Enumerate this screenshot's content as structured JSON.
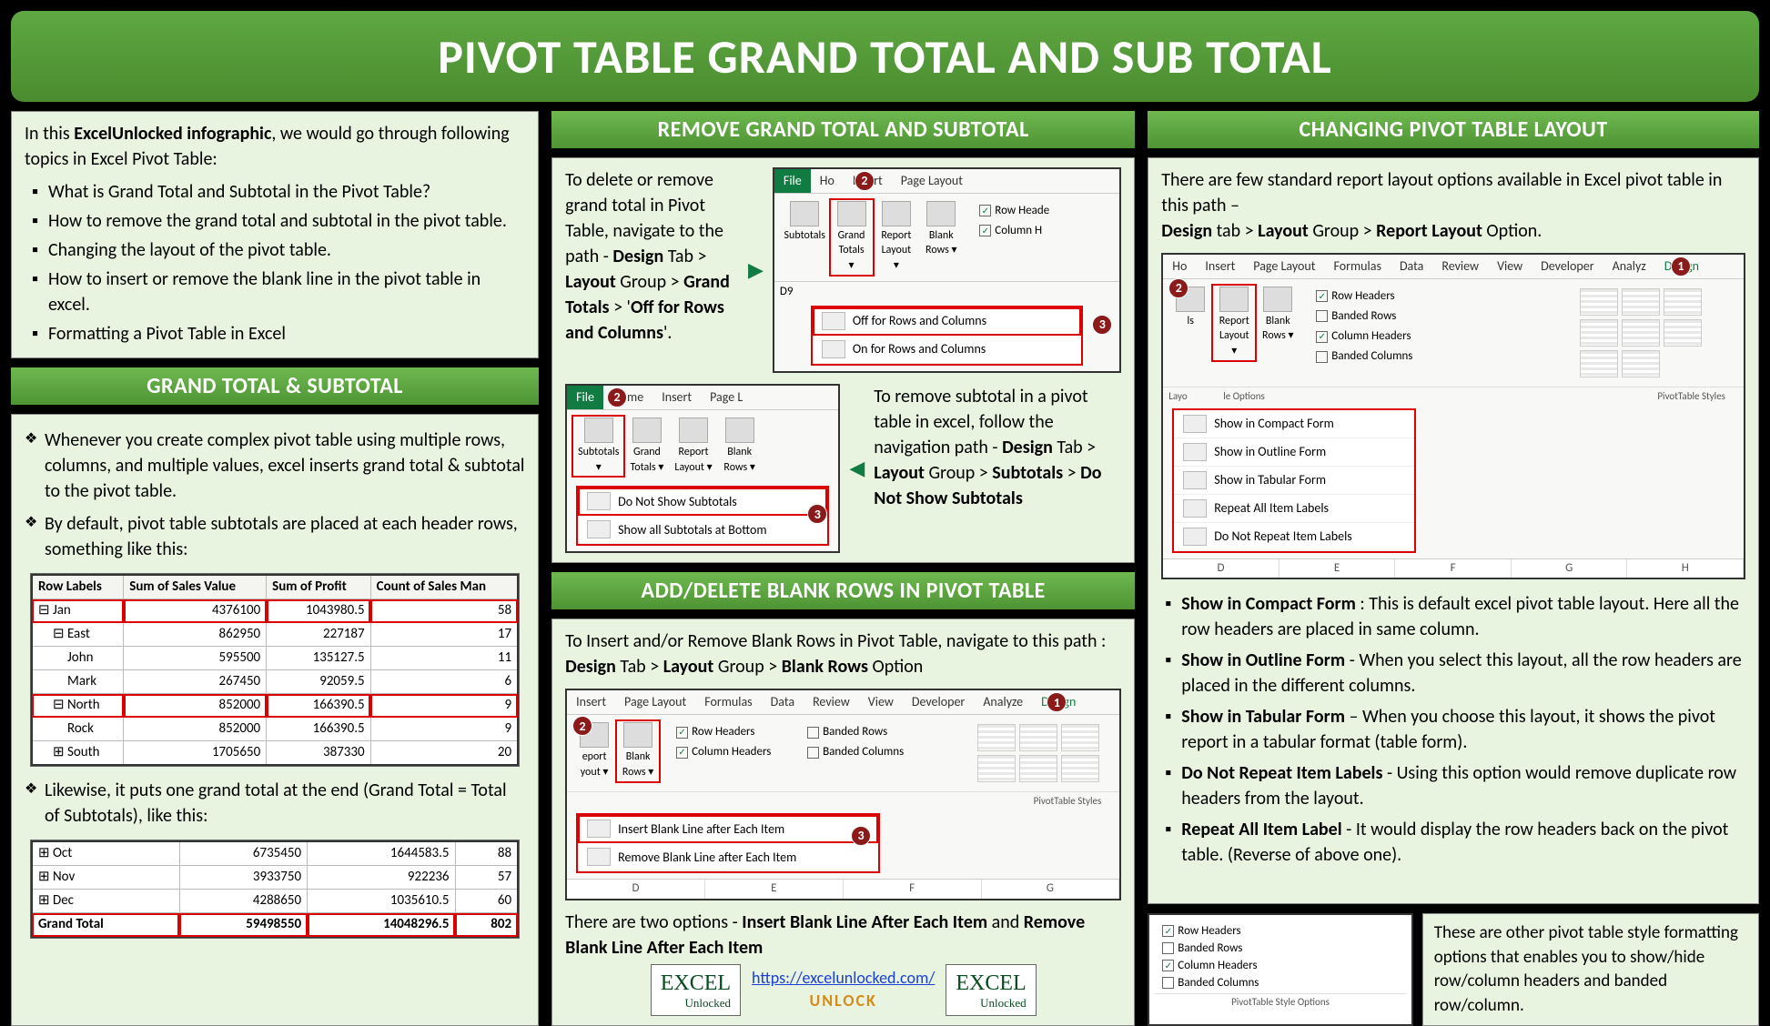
{
  "title": "PIVOT TABLE GRAND TOTAL AND SUB TOTAL",
  "intro": {
    "lead_html": "In this <b>ExcelUnlocked infographic</b>, we would go through following topics in Excel Pivot Table:",
    "topics": [
      "What is Grand Total and Subtotal in the Pivot Table?",
      "How to remove the grand total and subtotal in the pivot table.",
      "Changing the layout of the pivot table.",
      "How to insert or remove the blank line in the pivot table in excel.",
      "Formatting a Pivot Table in Excel"
    ]
  },
  "sec_gtst": {
    "header": "GRAND TOTAL & SUBTOTAL",
    "b1": "Whenever you create complex pivot table using multiple rows, columns, and multiple values, excel inserts grand total & subtotal to the pivot table.",
    "b2": "By default, pivot table subtotals are placed at each header rows, something like this:",
    "b3": "Likewise, it puts one grand total at the end (Grand Total = Total of Subtotals), like this:",
    "table1": {
      "headers": [
        "Row Labels",
        "Sum of Sales Value",
        "Sum of Profit",
        "Count of Sales Man"
      ],
      "rows": [
        {
          "lvl": 0,
          "exp": "⊟",
          "label": "Jan",
          "v": [
            "4376100",
            "1043980.5",
            "58"
          ],
          "hl": true
        },
        {
          "lvl": 1,
          "exp": "⊟",
          "label": "East",
          "v": [
            "862950",
            "227187",
            "17"
          ]
        },
        {
          "lvl": 2,
          "label": "John",
          "v": [
            "595500",
            "135127.5",
            "11"
          ]
        },
        {
          "lvl": 2,
          "label": "Mark",
          "v": [
            "267450",
            "92059.5",
            "6"
          ]
        },
        {
          "lvl": 1,
          "exp": "⊟",
          "label": "North",
          "v": [
            "852000",
            "166390.5",
            "9"
          ],
          "hl": true
        },
        {
          "lvl": 2,
          "label": "Rock",
          "v": [
            "852000",
            "166390.5",
            "9"
          ]
        },
        {
          "lvl": 1,
          "exp": "⊞",
          "label": "South",
          "v": [
            "1705650",
            "387330",
            "20"
          ]
        }
      ]
    },
    "table2": {
      "rows": [
        {
          "exp": "⊞",
          "label": "Oct",
          "v": [
            "6735450",
            "1644583.5",
            "88"
          ]
        },
        {
          "exp": "⊞",
          "label": "Nov",
          "v": [
            "3933750",
            "922236",
            "57"
          ]
        },
        {
          "exp": "⊞",
          "label": "Dec",
          "v": [
            "4288650",
            "1035610.5",
            "60"
          ]
        },
        {
          "label": "Grand Total",
          "v": [
            "59498550",
            "14048296.5",
            "802"
          ],
          "hl": true,
          "bold": true
        }
      ]
    }
  },
  "sec_remove": {
    "header": "REMOVE GRAND TOTAL AND SUBTOTAL",
    "p1_html": "To delete or remove grand total in Pivot Table, navigate to the path - <b>Design</b> Tab > <b>Layout</b> Group > <b>Grand Totals</b> > '<b>Off for Rows and Columns</b>'.",
    "p2_html": "To remove subtotal in a pivot table in excel, follow the navigation path - <b>Design</b> Tab > <b>Layout</b> Group > <b>Subtotals</b> > <b>Do Not Show Subtotals</b>",
    "ribbon1": {
      "tabs": [
        "File",
        "Ho",
        "Insert",
        "Page Layout"
      ],
      "buttons": [
        "Subtotals",
        "Grand Totals ▾",
        "Report Layout ▾",
        "Blank Rows ▾"
      ],
      "checks": [
        "Row Heade",
        "Column H"
      ],
      "menu": [
        "Off for Rows and Columns",
        "On for Rows and Columns"
      ],
      "cell": "D9"
    },
    "ribbon2": {
      "tabs": [
        "File",
        "Home",
        "Insert",
        "Page L"
      ],
      "buttons": [
        "Subtotals ▾",
        "Grand Totals ▾",
        "Report Layout ▾",
        "Blank Rows ▾"
      ],
      "menu": [
        "Do Not Show Subtotals",
        "Show all Subtotals at Bottom"
      ]
    }
  },
  "sec_blank": {
    "header": "ADD/DELETE BLANK ROWS IN PIVOT TABLE",
    "p1_html": "To Insert and/or Remove Blank Rows in Pivot Table, navigate to this path :<br><b>Design</b> Tab > <b>Layout</b> Group > <b>Blank Rows</b> Option",
    "p2_html": "There are two options - <b>Insert Blank Line After Each Item</b> and <b>Remove Blank Line After Each Item</b>",
    "ribbon": {
      "tabs": [
        "Insert",
        "Page Layout",
        "Formulas",
        "Data",
        "Review",
        "View",
        "Developer",
        "Analyze",
        "Design"
      ],
      "buttons": [
        "eport yout ▾",
        "Blank Rows ▾"
      ],
      "checks": [
        {
          "label": "Row Headers",
          "checked": true
        },
        {
          "label": "Banded Rows",
          "checked": false
        },
        {
          "label": "Column Headers",
          "checked": true
        },
        {
          "label": "Banded Columns",
          "checked": false
        }
      ],
      "menu": [
        "Insert Blank Line after Each Item",
        "Remove Blank Line after Each Item"
      ],
      "group_label": "PivotTable Styles",
      "sheet_cols": [
        "D",
        "E",
        "F",
        "G"
      ]
    }
  },
  "sec_layout": {
    "header": "CHANGING PIVOT TABLE LAYOUT",
    "p1_html": "There are few standard report layout options available in Excel pivot table in this path –<br><b>Design</b> tab > <b>Layout</b> Group > <b>Report Layout</b> Option.",
    "ribbon": {
      "tabs": [
        "Ho",
        "Insert",
        "Page Layout",
        "Formulas",
        "Data",
        "Review",
        "View",
        "Developer",
        "Analyz",
        "Design"
      ],
      "buttons": [
        "ls",
        "Report Layout ▾",
        "Blank Rows ▾"
      ],
      "checks": [
        {
          "label": "Row Headers",
          "checked": true
        },
        {
          "label": "Banded Rows",
          "checked": false
        },
        {
          "label": "Column Headers",
          "checked": true
        },
        {
          "label": "Banded Columns",
          "checked": false
        }
      ],
      "menu": [
        "Show in Compact Form",
        "Show in Outline Form",
        "Show in Tabular Form",
        "Repeat All Item Labels",
        "Do Not Repeat Item Labels"
      ],
      "group1": "le Options",
      "group2": "PivotTable Styles",
      "layo": "Layo",
      "sheet_cols": [
        "D",
        "E",
        "F",
        "G",
        "H"
      ]
    },
    "items": [
      {
        "html": "<b>Show in Compact Form</b> : This is default excel pivot table layout. Here all the row headers are placed in same column."
      },
      {
        "html": "<b>Show in Outline Form</b> - When you select this layout, all the row headers are placed in the different columns."
      },
      {
        "html": "<b>Show in Tabular Form</b> – When you choose this layout, it shows the pivot report in a tabular format (table form)."
      },
      {
        "html": "<b>Do Not Repeat Item Labels</b> - Using this option would remove duplicate row headers from the layout."
      },
      {
        "html": "<b>Repeat All Item Label</b> - It would display the row headers back on the pivot table. (Reverse of above one)."
      }
    ]
  },
  "style_opts": {
    "checks": [
      {
        "label": "Row Headers",
        "checked": true
      },
      {
        "label": "Banded Rows",
        "checked": false
      },
      {
        "label": "Column Headers",
        "checked": true
      },
      {
        "label": "Banded Columns",
        "checked": false
      }
    ],
    "group_label": "PivotTable Style Options",
    "desc": "These are other pivot table style formatting options that enables you to show/hide row/column headers and banded row/column."
  },
  "footer": {
    "logo_main": "EXCEL",
    "logo_sub": "Unlocked",
    "url": "https://excelunlocked.com/",
    "unlock": "UNLOCK"
  }
}
